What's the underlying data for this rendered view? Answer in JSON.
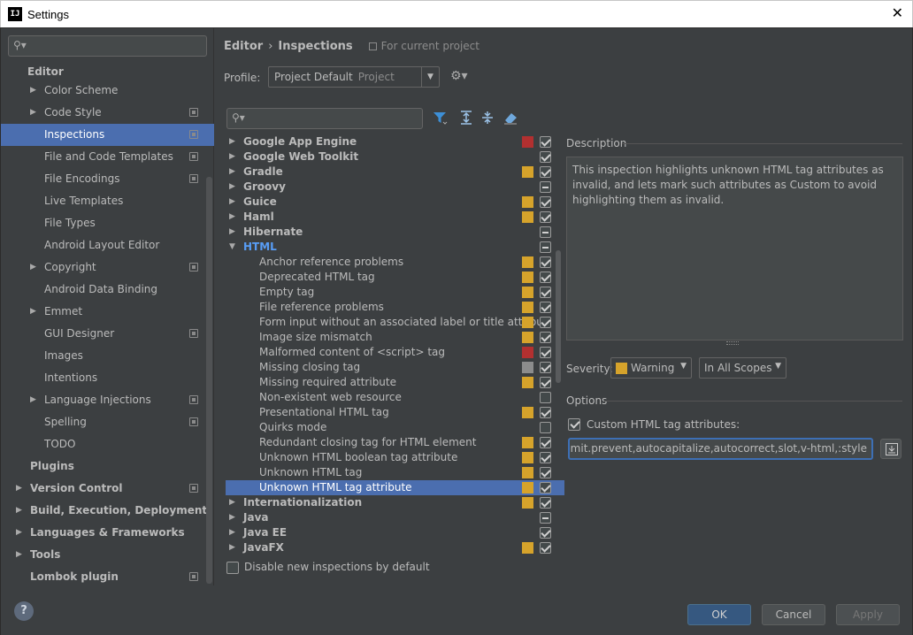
{
  "window": {
    "title": "Settings",
    "app_icon": "IJ",
    "close": "✕"
  },
  "sidebar": {
    "search_placeholder": "",
    "items": [
      {
        "label": "Editor",
        "level": 0,
        "arrow": false,
        "bold": true,
        "proj": false
      },
      {
        "label": "Color Scheme",
        "level": 1,
        "arrow": true,
        "proj": false
      },
      {
        "label": "Code Style",
        "level": 1,
        "arrow": true,
        "proj": true
      },
      {
        "label": "Inspections",
        "level": 1,
        "arrow": false,
        "proj": true,
        "selected": true
      },
      {
        "label": "File and Code Templates",
        "level": 1,
        "arrow": false,
        "proj": true
      },
      {
        "label": "File Encodings",
        "level": 1,
        "arrow": false,
        "proj": true
      },
      {
        "label": "Live Templates",
        "level": 1,
        "arrow": false,
        "proj": false
      },
      {
        "label": "File Types",
        "level": 1,
        "arrow": false,
        "proj": false
      },
      {
        "label": "Android Layout Editor",
        "level": 1,
        "arrow": false,
        "proj": false
      },
      {
        "label": "Copyright",
        "level": 1,
        "arrow": true,
        "proj": true
      },
      {
        "label": "Android Data Binding",
        "level": 1,
        "arrow": false,
        "proj": false
      },
      {
        "label": "Emmet",
        "level": 1,
        "arrow": true,
        "proj": false
      },
      {
        "label": "GUI Designer",
        "level": 1,
        "arrow": false,
        "proj": true
      },
      {
        "label": "Images",
        "level": 1,
        "arrow": false,
        "proj": false
      },
      {
        "label": "Intentions",
        "level": 1,
        "arrow": false,
        "proj": false
      },
      {
        "label": "Language Injections",
        "level": 1,
        "arrow": true,
        "proj": true
      },
      {
        "label": "Spelling",
        "level": 1,
        "arrow": false,
        "proj": true
      },
      {
        "label": "TODO",
        "level": 1,
        "arrow": false,
        "proj": false
      },
      {
        "label": "Plugins",
        "level": 0,
        "arrow": false,
        "bold": true,
        "proj": false
      },
      {
        "label": "Version Control",
        "level": 0,
        "arrow": true,
        "bold": true,
        "proj": true
      },
      {
        "label": "Build, Execution, Deployment",
        "level": 0,
        "arrow": true,
        "bold": true,
        "proj": false
      },
      {
        "label": "Languages & Frameworks",
        "level": 0,
        "arrow": true,
        "bold": true,
        "proj": false
      },
      {
        "label": "Tools",
        "level": 0,
        "arrow": true,
        "bold": true,
        "proj": false
      },
      {
        "label": "Lombok plugin",
        "level": 0,
        "arrow": false,
        "bold": true,
        "proj": true
      }
    ]
  },
  "header": {
    "crumb1": "Editor",
    "crumb_sep": "›",
    "crumb2": "Inspections",
    "for_project": "For current project"
  },
  "profile": {
    "label": "Profile:",
    "value": "Project Default",
    "scope": "Project"
  },
  "inspections": [
    {
      "label": "Google App Engine",
      "group": true,
      "expanded": false,
      "sev": "#b23030",
      "check": "on"
    },
    {
      "label": "Google Web Toolkit",
      "group": true,
      "expanded": false,
      "sev": "",
      "check": "on"
    },
    {
      "label": "Gradle",
      "group": true,
      "expanded": false,
      "sev": "#d6a32b",
      "check": "on"
    },
    {
      "label": "Groovy",
      "group": true,
      "expanded": false,
      "sev": "",
      "check": "ind"
    },
    {
      "label": "Guice",
      "group": true,
      "expanded": false,
      "sev": "#d6a32b",
      "check": "on"
    },
    {
      "label": "Haml",
      "group": true,
      "expanded": false,
      "sev": "#d6a32b",
      "check": "on"
    },
    {
      "label": "Hibernate",
      "group": true,
      "expanded": false,
      "sev": "",
      "check": "ind"
    },
    {
      "label": "HTML",
      "group": true,
      "expanded": true,
      "html": true,
      "sev": "",
      "check": "ind"
    },
    {
      "label": "Anchor reference problems",
      "group": false,
      "sev": "#d6a32b",
      "check": "on"
    },
    {
      "label": "Deprecated HTML tag",
      "group": false,
      "sev": "#d6a32b",
      "check": "on"
    },
    {
      "label": "Empty tag",
      "group": false,
      "sev": "#d6a32b",
      "check": "on"
    },
    {
      "label": "File reference problems",
      "group": false,
      "sev": "#d6a32b",
      "check": "on"
    },
    {
      "label": "Form input without an associated label or title attribut",
      "group": false,
      "sev": "#d6a32b",
      "check": "on"
    },
    {
      "label": "Image size mismatch",
      "group": false,
      "sev": "#d6a32b",
      "check": "on"
    },
    {
      "label": "Malformed content of <script> tag",
      "group": false,
      "sev": "#b23030",
      "check": "on"
    },
    {
      "label": "Missing closing tag",
      "group": false,
      "sev": "#8c8c8c",
      "check": "on"
    },
    {
      "label": "Missing required attribute",
      "group": false,
      "sev": "#d6a32b",
      "check": "on"
    },
    {
      "label": "Non-existent web resource",
      "group": false,
      "sev": "",
      "check": "off"
    },
    {
      "label": "Presentational HTML tag",
      "group": false,
      "sev": "#d6a32b",
      "check": "on"
    },
    {
      "label": "Quirks mode",
      "group": false,
      "sev": "",
      "check": "off"
    },
    {
      "label": "Redundant closing tag for HTML element",
      "group": false,
      "sev": "#d6a32b",
      "check": "on"
    },
    {
      "label": "Unknown HTML boolean tag attribute",
      "group": false,
      "sev": "#d6a32b",
      "check": "on"
    },
    {
      "label": "Unknown HTML tag",
      "group": false,
      "sev": "#d6a32b",
      "check": "on"
    },
    {
      "label": "Unknown HTML tag attribute",
      "group": false,
      "selected": true,
      "sev": "#d6a32b",
      "check": "on"
    },
    {
      "label": "Internationalization",
      "group": true,
      "expanded": false,
      "sev": "#d6a32b",
      "check": "on"
    },
    {
      "label": "Java",
      "group": true,
      "expanded": false,
      "sev": "",
      "check": "ind"
    },
    {
      "label": "Java EE",
      "group": true,
      "expanded": false,
      "sev": "",
      "check": "on"
    },
    {
      "label": "JavaFX",
      "group": true,
      "expanded": false,
      "sev": "#d6a32b",
      "check": "on"
    }
  ],
  "disable_new": "Disable new inspections by default",
  "description": {
    "label": "Description",
    "text": "This inspection highlights unknown HTML tag attributes as invalid, and lets mark such attributes as Custom to avoid highlighting them as invalid."
  },
  "severity": {
    "label": "Severity:",
    "value": "Warning",
    "color": "#d6a32b",
    "scope": "In All Scopes"
  },
  "options": {
    "label": "Options",
    "custom_label": "Custom HTML tag attributes:",
    "custom_value": "ı,@submit.prevent,autocapitalize,autocorrect,slot,v-html,:style"
  },
  "buttons": {
    "help": "?",
    "ok": "OK",
    "cancel": "Cancel",
    "apply": "Apply"
  }
}
